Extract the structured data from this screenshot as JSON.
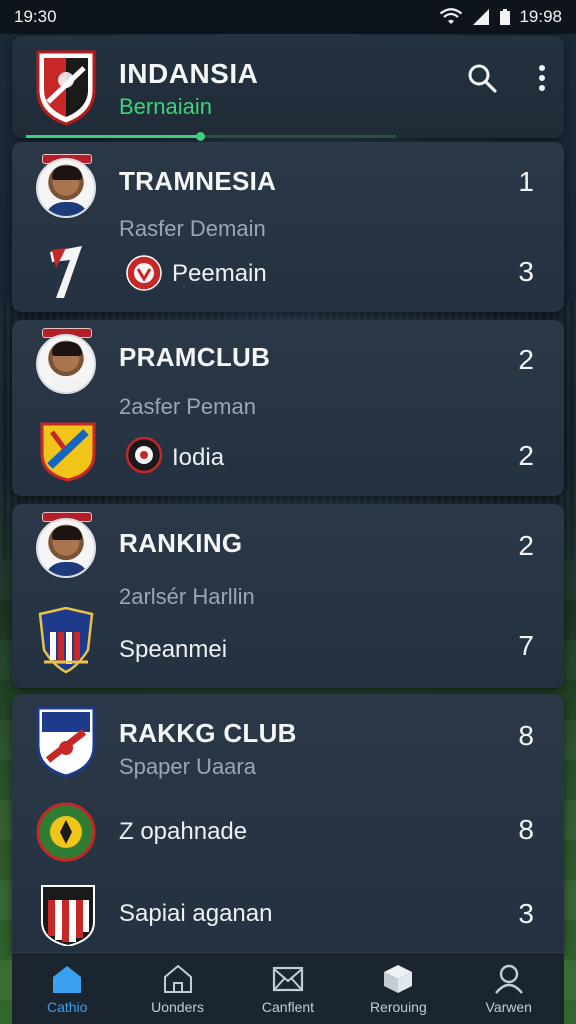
{
  "status_bar": {
    "time_left": "19:30",
    "time_right": "19:98"
  },
  "header": {
    "title": "INDANSIA",
    "subtitle": "Bernaiain",
    "progress": 0.47
  },
  "cards": [
    {
      "rows": [
        {
          "name": "TRAMNESIA",
          "value": "1"
        },
        {
          "sub": "Rasfer Demain"
        },
        {
          "label": "Peemain",
          "value": "3"
        }
      ]
    },
    {
      "rows": [
        {
          "name": "PRAMCLUB",
          "value": "2"
        },
        {
          "sub": "2asfer Peman"
        },
        {
          "label": "Iodia",
          "value": "2"
        }
      ]
    },
    {
      "rows": [
        {
          "name": "RANKING",
          "value": "2"
        },
        {
          "sub": "2arlsér Harllin"
        },
        {
          "label": "Speanmei",
          "value": "7"
        }
      ]
    },
    {
      "rows": [
        {
          "name": "RAKKG CLUB",
          "value": "8"
        },
        {
          "sub": "Spaper Uaara"
        },
        {
          "label": "Z opahnade",
          "value": "8"
        },
        {
          "label": "Sapiai aganan",
          "value": "3"
        }
      ]
    }
  ],
  "bottom_nav": [
    {
      "label": "Cathio",
      "icon": "home-icon",
      "active": true
    },
    {
      "label": "Uonders",
      "icon": "house-outline-icon",
      "active": false
    },
    {
      "label": "Canflent",
      "icon": "mail-icon",
      "active": false
    },
    {
      "label": "Rerouing",
      "icon": "box-icon",
      "active": false
    },
    {
      "label": "Varwen",
      "icon": "profile-icon",
      "active": false
    }
  ],
  "colors": {
    "accent_green": "#3fd17a",
    "accent_blue": "#3aa0f0",
    "card_bg": "#2a3848"
  }
}
